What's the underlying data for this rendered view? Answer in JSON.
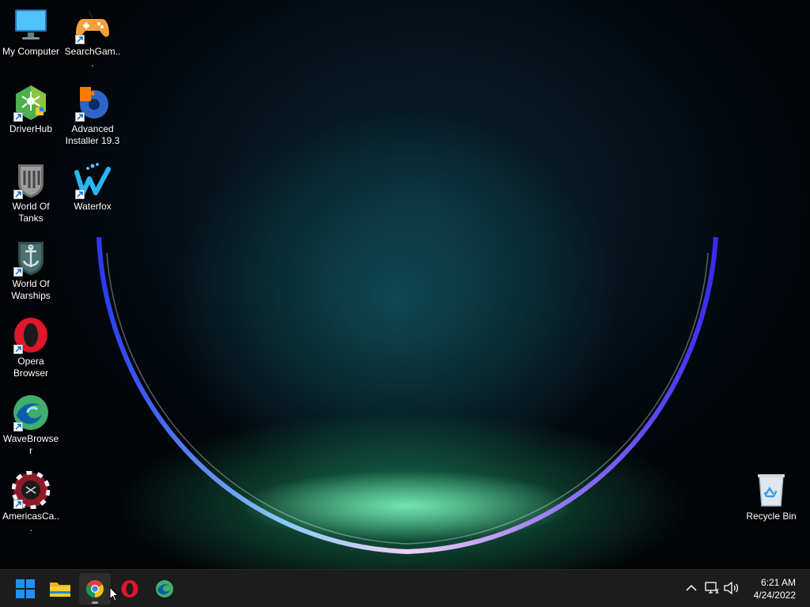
{
  "desktop": {
    "icons": [
      {
        "label": "My Computer"
      },
      {
        "label": "SearchGam..."
      },
      {
        "label": "DriverHub"
      },
      {
        "label": "Advanced Installer 19.3"
      },
      {
        "label": "World Of Tanks"
      },
      {
        "label": "Waterfox"
      },
      {
        "label": "World Of Warships"
      },
      {
        "label": "Opera Browser"
      },
      {
        "label": "WaveBrowser"
      },
      {
        "label": "AmericasCa..."
      },
      {
        "label": "Recycle Bin"
      }
    ]
  },
  "taskbar": {
    "pinned": [
      "windows-start",
      "file-explorer",
      "chrome",
      "opera",
      "wavebrowser"
    ],
    "active_app": "chrome",
    "clock": {
      "time": "6:21 AM",
      "date": "4/24/2022"
    }
  },
  "colors": {
    "taskbar_bg": "#1c1c1c",
    "windows_blue": "#1e90ff",
    "opera_red": "#e0162b"
  }
}
